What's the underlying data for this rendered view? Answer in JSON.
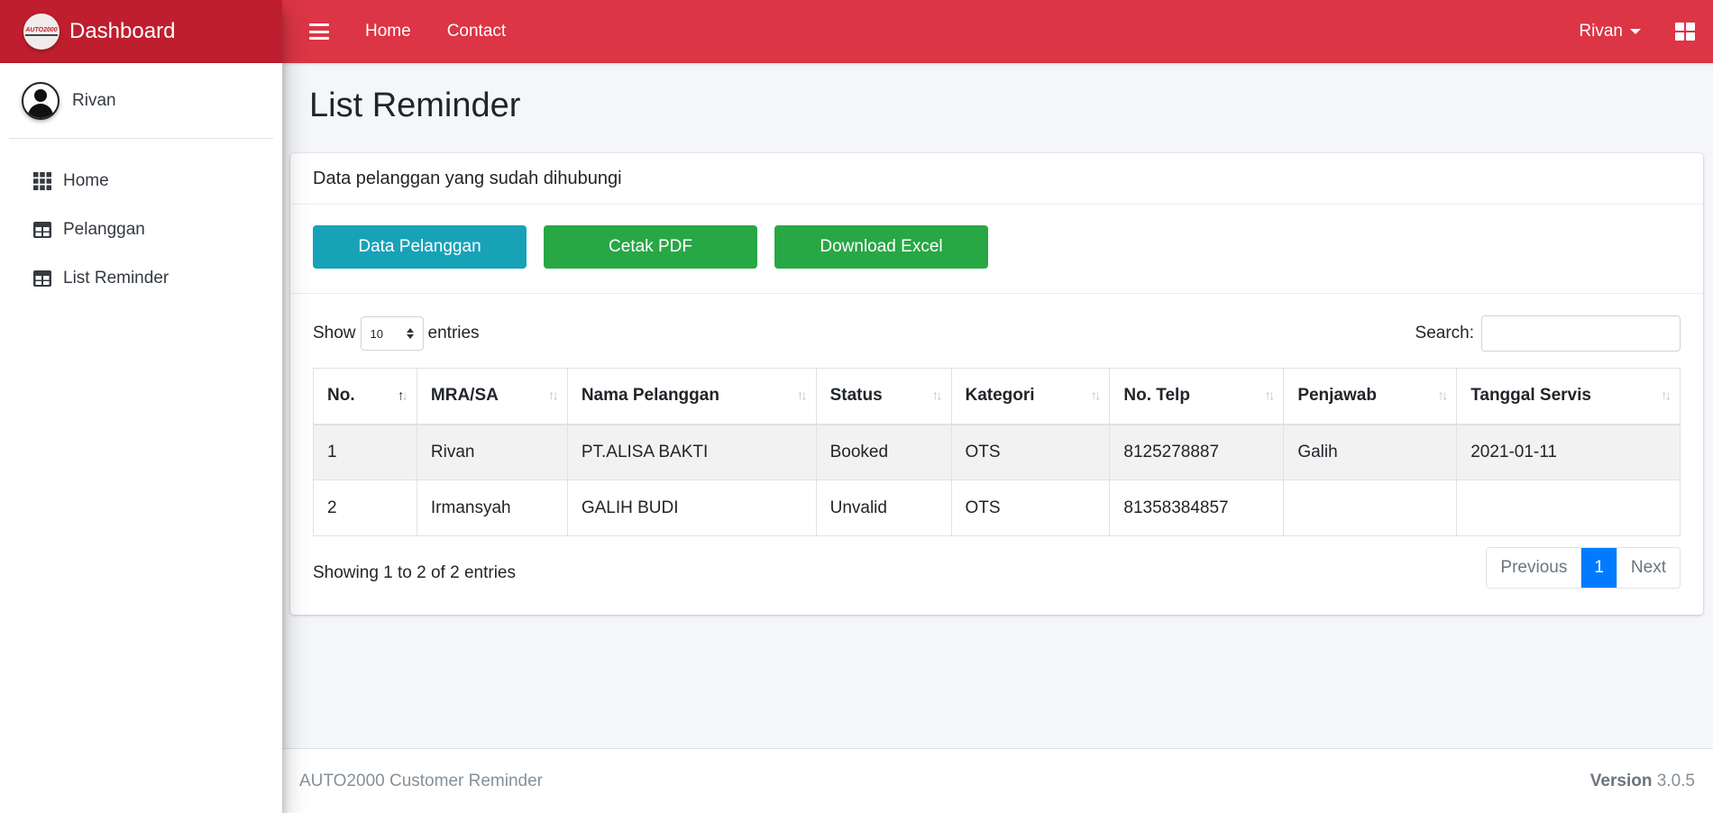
{
  "brand": {
    "title": "Dashboard",
    "logo_text": "AUTO2000"
  },
  "user": {
    "name": "Rivan"
  },
  "sidebar": {
    "items": [
      {
        "label": "Home",
        "icon": "grid-icon"
      },
      {
        "label": "Pelanggan",
        "icon": "table-icon"
      },
      {
        "label": "List Reminder",
        "icon": "table-icon"
      }
    ]
  },
  "navbar": {
    "links": [
      "Home",
      "Contact"
    ],
    "user_menu": "Rivan"
  },
  "page": {
    "title": "List Reminder",
    "card_title": "Data pelanggan yang sudah dihubungi",
    "buttons": {
      "data_pelanggan": "Data Pelanggan",
      "cetak_pdf": "Cetak PDF",
      "download_excel": "Download Excel"
    }
  },
  "table": {
    "show_label": "Show",
    "entries_label": "entries",
    "page_size": "10",
    "search_label": "Search:",
    "search_value": "",
    "columns": [
      "No.",
      "MRA/SA",
      "Nama Pelanggan",
      "Status",
      "Kategori",
      "No. Telp",
      "Penjawab",
      "Tanggal Servis"
    ],
    "rows": [
      [
        "1",
        "Rivan",
        "PT.ALISA BAKTI",
        "Booked",
        "OTS",
        "8125278887",
        "Galih",
        "2021-01-11"
      ],
      [
        "2",
        "Irmansyah",
        "GALIH BUDI",
        "Unvalid",
        "OTS",
        "81358384857",
        "",
        ""
      ]
    ],
    "info": "Showing 1 to 2 of 2 entries",
    "pagination": {
      "previous": "Previous",
      "current": "1",
      "next": "Next"
    }
  },
  "footer": {
    "left": "AUTO2000 Customer Reminder",
    "version_label": "Version",
    "version": "3.0.5"
  },
  "colors": {
    "navbar": "#dc3545",
    "brand": "#bf1e2e",
    "info_button": "#17a2b8",
    "success_button": "#28a745",
    "pagination_active": "#007bff"
  }
}
